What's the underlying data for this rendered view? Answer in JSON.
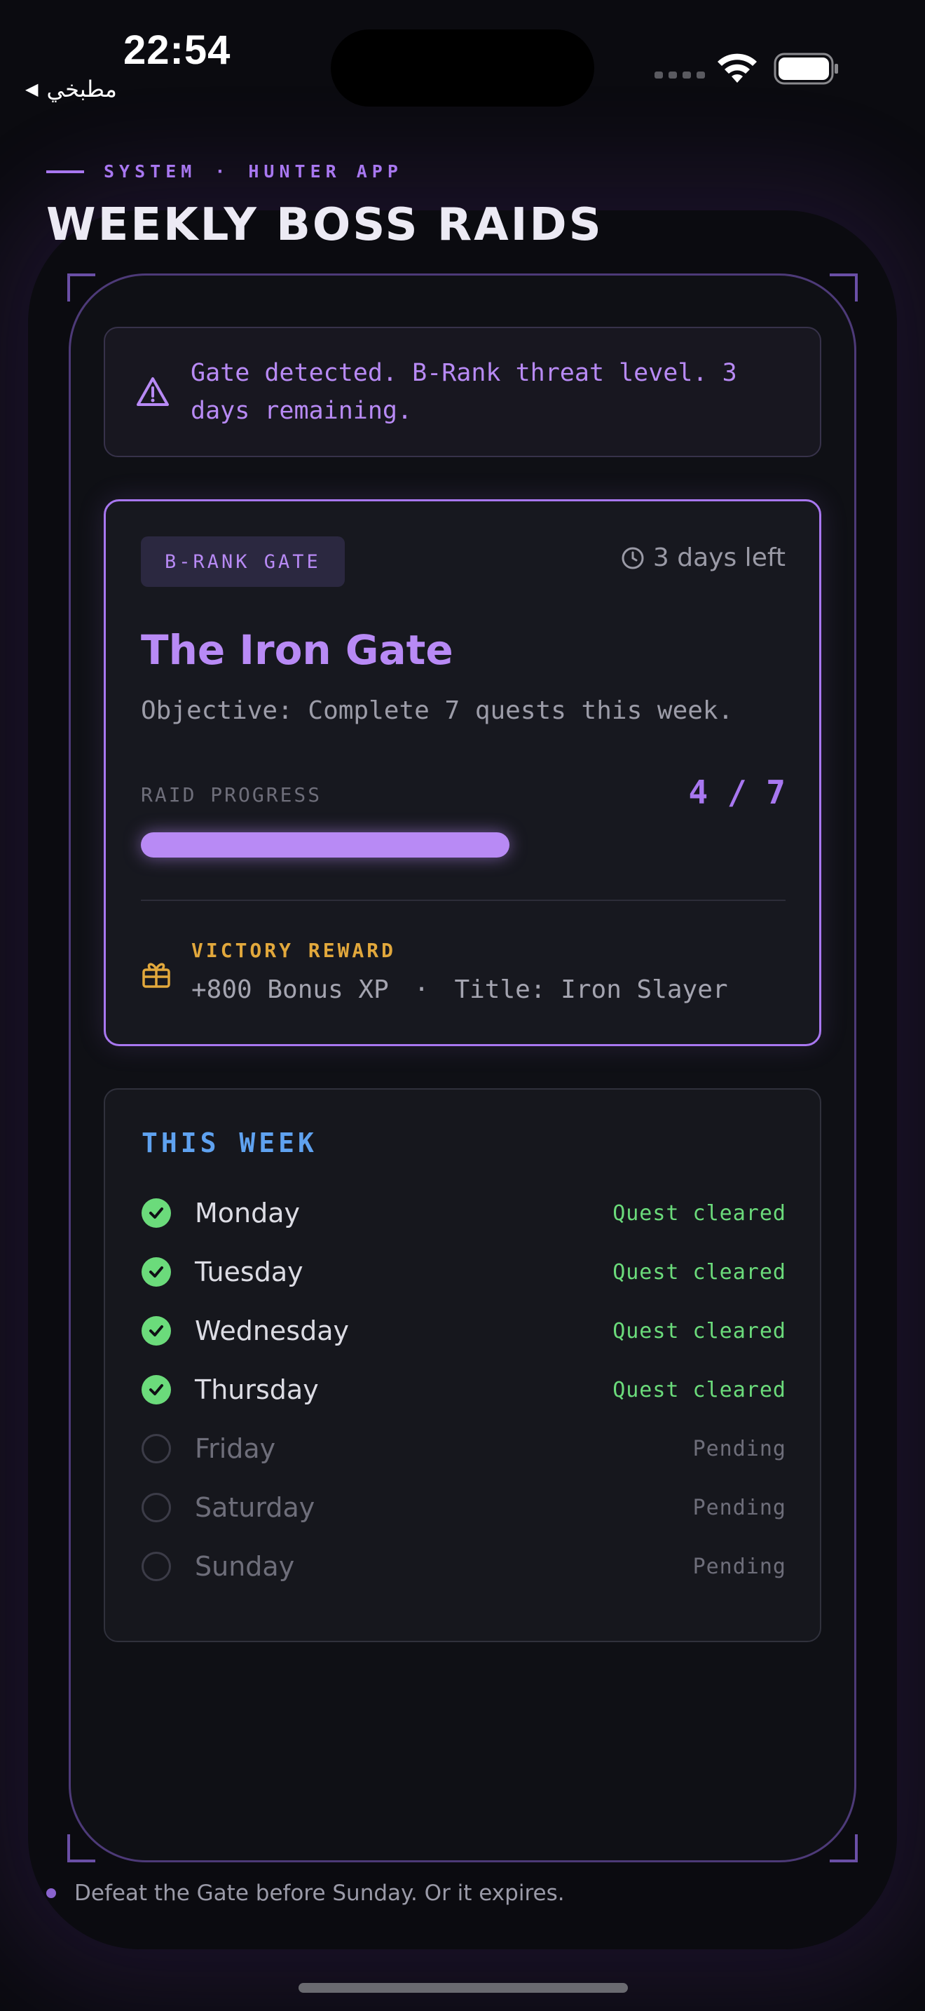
{
  "status_bar": {
    "time": "22:54",
    "back_label": "مطبخي"
  },
  "header": {
    "eyebrow_left": "SYSTEM",
    "eyebrow_sep": "·",
    "eyebrow_right": "HUNTER APP",
    "title": "WEEKLY BOSS RAIDS"
  },
  "alert": {
    "icon": "warning-triangle-icon",
    "text": "Gate detected. B-Rank threat level. 3 days remaining."
  },
  "raid": {
    "rank_badge": "B-RANK GATE",
    "days_left": "3 days left",
    "title": "The Iron Gate",
    "objective": "Objective: Complete 7 quests this week.",
    "progress_label": "RAID PROGRESS",
    "progress_count": "4 / 7",
    "progress_done": 4,
    "progress_total": 7,
    "reward_label": "VICTORY REWARD",
    "reward_xp": "+800 Bonus XP",
    "reward_sep": "·",
    "reward_title": "Title: Iron Slayer"
  },
  "week": {
    "title": "THIS WEEK",
    "days": [
      {
        "name": "Monday",
        "status": "Quest cleared",
        "done": true
      },
      {
        "name": "Tuesday",
        "status": "Quest cleared",
        "done": true
      },
      {
        "name": "Wednesday",
        "status": "Quest cleared",
        "done": true
      },
      {
        "name": "Thursday",
        "status": "Quest cleared",
        "done": true
      },
      {
        "name": "Friday",
        "status": "Pending",
        "done": false
      },
      {
        "name": "Saturday",
        "status": "Pending",
        "done": false
      },
      {
        "name": "Sunday",
        "status": "Pending",
        "done": false
      }
    ]
  },
  "footer": {
    "note": "Defeat the Gate before Sunday. Or it expires."
  },
  "colors": {
    "accent": "#a877f0",
    "success": "#6bdb7b",
    "week_title": "#5fa2f0",
    "reward": "#e2a83c",
    "background": "#0b0b10"
  }
}
